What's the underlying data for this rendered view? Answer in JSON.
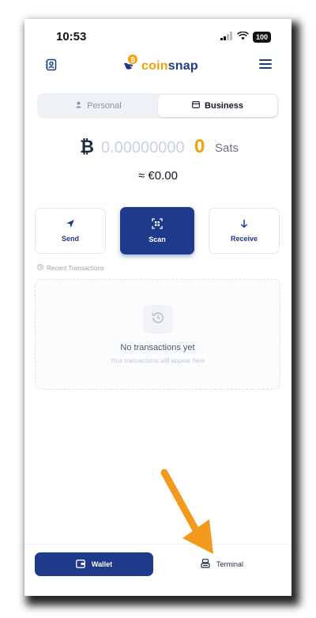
{
  "status": {
    "time": "10:53",
    "battery": "100"
  },
  "header": {
    "logo_text": "coinsnap",
    "logo_c": "coin",
    "logo_rest": "snap"
  },
  "toggle": {
    "personal_label": "Personal",
    "business_label": "Business"
  },
  "balance": {
    "symbol": "₿",
    "zeros": "0.00000000",
    "last_digit": "0",
    "unit": "Sats",
    "fiat": "≈ €0.00"
  },
  "actions": {
    "send_label": "Send",
    "scan_label": "Scan",
    "receive_label": "Receive"
  },
  "transactions": {
    "section_label": "Recent Transactions",
    "empty_title": "No transactions yet",
    "empty_subtitle": "Your transactions will appear here"
  },
  "nav": {
    "wallet_label": "Wallet",
    "terminal_label": "Terminal"
  },
  "colors": {
    "brand": "#1e3a8a",
    "accent": "#f59e0b",
    "annotation_arrow": "#f39a1e"
  }
}
